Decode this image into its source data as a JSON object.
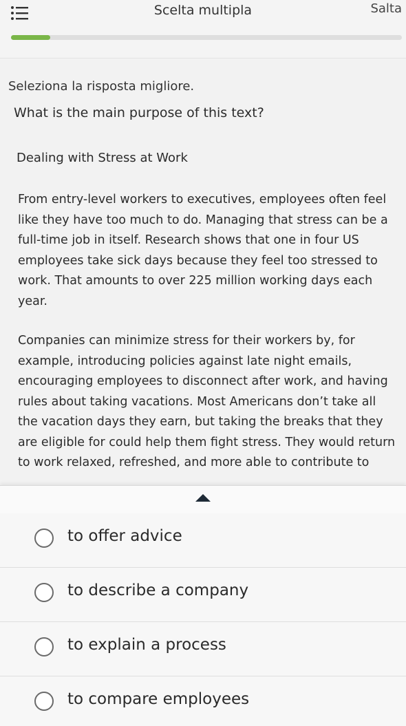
{
  "header": {
    "title": "Scelta multipla",
    "skip_label": "Salta",
    "menu_icon": "list-icon"
  },
  "progress": {
    "fraction": 0.1,
    "color": "#7ab648"
  },
  "instruction": "Seleziona la risposta migliore.",
  "question": "What is the main purpose of this text?",
  "passage": {
    "title": "Dealing with Stress at Work",
    "paragraphs": [
      "From entry-level workers to executives, employees often feel like they have too much to do. Managing that stress can be a full-time job in itself. Research shows that one in four US employees take sick days because they feel too stressed to work. That amounts to over 225 million working days each year.",
      "Companies can minimize stress for their workers by, for example, introducing policies against late night emails, encouraging employees to disconnect after work, and having rules about taking vacations. Most Americans don’t take all the vacation days they earn, but taking the breaks that they are eligible for could help them fight stress. They would return to work relaxed, refreshed, and more able to contribute to"
    ]
  },
  "collapse_icon": "caret-up-icon",
  "options": [
    {
      "label": "to offer advice"
    },
    {
      "label": "to describe a company"
    },
    {
      "label": "to explain a process"
    },
    {
      "label": "to compare employees"
    }
  ]
}
